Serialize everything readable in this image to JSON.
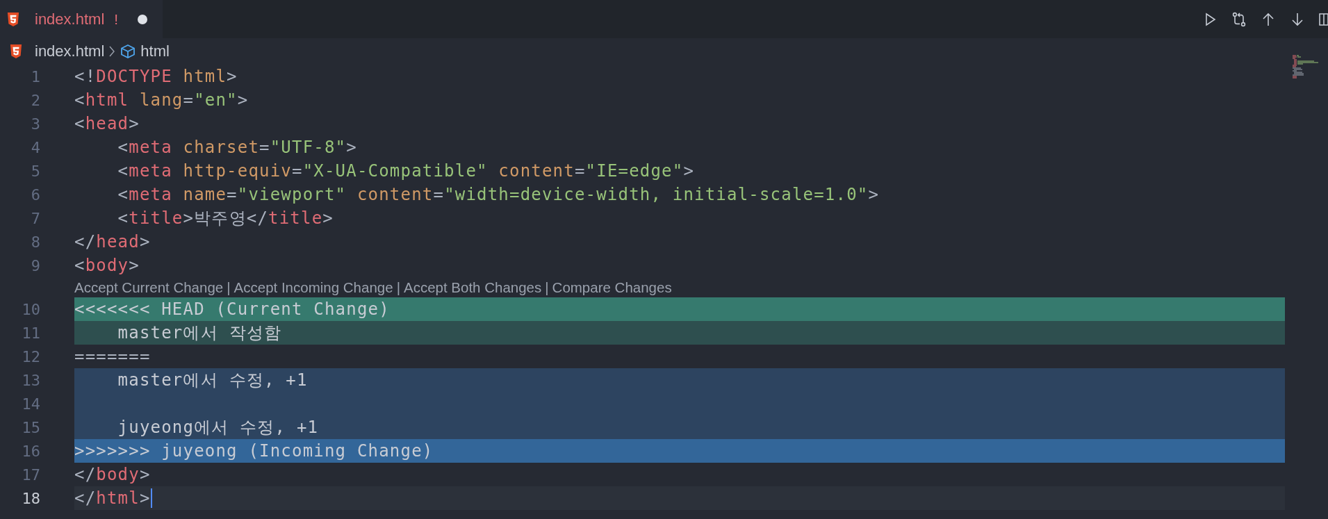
{
  "tab": {
    "label": "index.html",
    "problem": "!",
    "modified": true
  },
  "breadcrumb": [
    "index.html",
    "html"
  ],
  "editor": {
    "lines": [
      {
        "kind": "code",
        "number": "1",
        "current": false,
        "tokens": [
          {
            "kind": "punct",
            "text": "<!"
          },
          {
            "kind": "tag",
            "text": "DOCTYPE"
          },
          {
            "kind": "attr",
            "text": " html"
          },
          {
            "kind": "punct",
            "text": ">"
          }
        ]
      },
      {
        "kind": "code",
        "number": "2",
        "current": false,
        "tokens": [
          {
            "kind": "punct",
            "text": "<"
          },
          {
            "kind": "tag",
            "text": "html"
          },
          {
            "kind": "attr",
            "text": " lang"
          },
          {
            "kind": "punct",
            "text": "="
          },
          {
            "kind": "string",
            "text": "\"en\""
          },
          {
            "kind": "punct",
            "text": ">"
          }
        ]
      },
      {
        "kind": "code",
        "number": "3",
        "current": false,
        "tokens": [
          {
            "kind": "punct",
            "text": "<"
          },
          {
            "kind": "tag",
            "text": "head"
          },
          {
            "kind": "punct",
            "text": ">"
          }
        ]
      },
      {
        "kind": "code",
        "number": "4",
        "current": false,
        "tokens": [
          {
            "kind": "punct",
            "text": "    <"
          },
          {
            "kind": "tag",
            "text": "meta"
          },
          {
            "kind": "attr",
            "text": " charset"
          },
          {
            "kind": "punct",
            "text": "="
          },
          {
            "kind": "string",
            "text": "\"UTF-8\""
          },
          {
            "kind": "punct",
            "text": ">"
          }
        ]
      },
      {
        "kind": "code",
        "number": "5",
        "current": false,
        "tokens": [
          {
            "kind": "punct",
            "text": "    <"
          },
          {
            "kind": "tag",
            "text": "meta"
          },
          {
            "kind": "attr",
            "text": " http-equiv"
          },
          {
            "kind": "punct",
            "text": "="
          },
          {
            "kind": "string",
            "text": "\"X-UA-Compatible\""
          },
          {
            "kind": "attr",
            "text": " content"
          },
          {
            "kind": "punct",
            "text": "="
          },
          {
            "kind": "string",
            "text": "\"IE=edge\""
          },
          {
            "kind": "punct",
            "text": ">"
          }
        ]
      },
      {
        "kind": "code",
        "number": "6",
        "current": false,
        "tokens": [
          {
            "kind": "punct",
            "text": "    <"
          },
          {
            "kind": "tag",
            "text": "meta"
          },
          {
            "kind": "attr",
            "text": " name"
          },
          {
            "kind": "punct",
            "text": "="
          },
          {
            "kind": "string",
            "text": "\"viewport\""
          },
          {
            "kind": "attr",
            "text": " content"
          },
          {
            "kind": "punct",
            "text": "="
          },
          {
            "kind": "string",
            "text": "\"width=device-width, initial-scale=1.0\""
          },
          {
            "kind": "punct",
            "text": ">"
          }
        ]
      },
      {
        "kind": "code",
        "number": "7",
        "current": false,
        "tokens": [
          {
            "kind": "punct",
            "text": "    <"
          },
          {
            "kind": "tag",
            "text": "title"
          },
          {
            "kind": "punct",
            "text": ">박주영</"
          },
          {
            "kind": "tag",
            "text": "title"
          },
          {
            "kind": "punct",
            "text": ">"
          }
        ]
      },
      {
        "kind": "code",
        "number": "8",
        "current": false,
        "tokens": [
          {
            "kind": "punct",
            "text": "</"
          },
          {
            "kind": "tag",
            "text": "head"
          },
          {
            "kind": "punct",
            "text": ">"
          }
        ]
      },
      {
        "kind": "code",
        "number": "9",
        "current": false,
        "tokens": [
          {
            "kind": "punct",
            "text": "<"
          },
          {
            "kind": "tag",
            "text": "body"
          },
          {
            "kind": "punct",
            "text": ">"
          }
        ]
      },
      {
        "kind": "codelens",
        "actions": [
          "Accept Current Change",
          "Accept Incoming Change",
          "Accept Both Changes",
          "Compare Changes"
        ],
        "separator": "|"
      },
      {
        "kind": "current-marker",
        "number": "10",
        "current": false,
        "tokens": [
          {
            "kind": "plain",
            "text": "<<<<<<< HEAD (Current Change)"
          }
        ]
      },
      {
        "kind": "current",
        "number": "11",
        "current": false,
        "tokens": [
          {
            "kind": "plain",
            "text": "    master에서 작성함"
          }
        ]
      },
      {
        "kind": "code",
        "number": "12",
        "current": false,
        "tokens": [
          {
            "kind": "plain",
            "text": "======="
          }
        ]
      },
      {
        "kind": "incoming",
        "number": "13",
        "current": false,
        "tokens": [
          {
            "kind": "plain",
            "text": "    master에서 수정, +1"
          }
        ]
      },
      {
        "kind": "incoming",
        "number": "14",
        "current": false
      },
      {
        "kind": "incoming",
        "number": "15",
        "current": false,
        "tokens": [
          {
            "kind": "plain",
            "text": "    juyeong에서 수정, +1"
          }
        ]
      },
      {
        "kind": "incoming-marker",
        "number": "16",
        "current": false,
        "tokens": [
          {
            "kind": "plain",
            "text": ">>>>>>> juyeong (Incoming Change)"
          }
        ]
      },
      {
        "kind": "code",
        "number": "17",
        "current": false,
        "tokens": [
          {
            "kind": "punct",
            "text": "</"
          },
          {
            "kind": "tag",
            "text": "body"
          },
          {
            "kind": "punct",
            "text": ">"
          }
        ]
      },
      {
        "kind": "code",
        "number": "18",
        "current": true,
        "tokens": [
          {
            "kind": "punct",
            "text": "</"
          },
          {
            "kind": "tag",
            "text": "html"
          },
          {
            "kind": "punct",
            "text": ">"
          }
        ]
      }
    ]
  }
}
